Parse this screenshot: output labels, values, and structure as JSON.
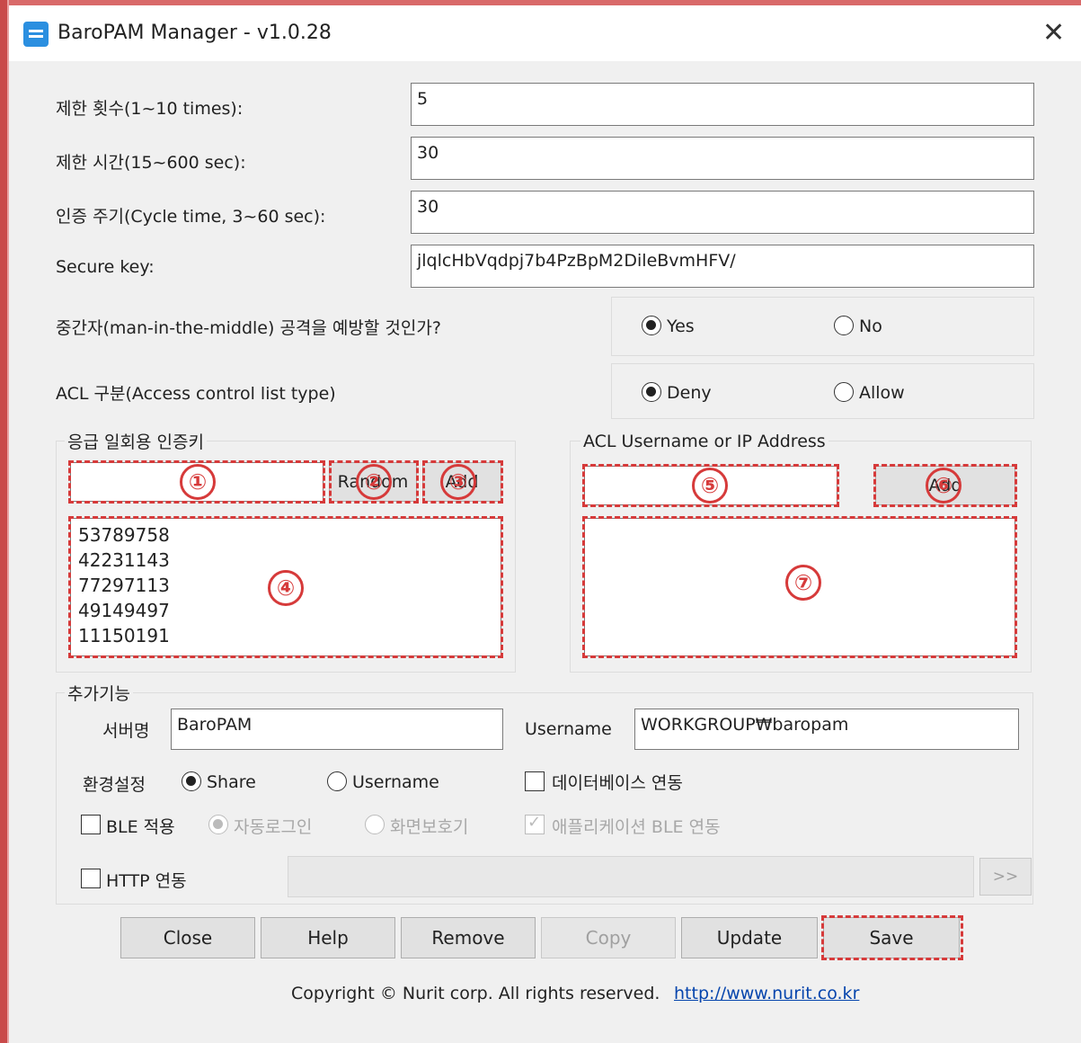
{
  "window": {
    "title": "BaroPAM Manager - v1.0.28",
    "close_glyph": "✕"
  },
  "settings": {
    "limit_count": {
      "label": "제한 횟수(1~10 times):",
      "value": "5"
    },
    "limit_time": {
      "label": "제한 시간(15~600 sec):",
      "value": "30"
    },
    "cycle": {
      "label": "인증 주기(Cycle time, 3~60 sec):",
      "value": "30"
    },
    "secure_key": {
      "label": "Secure key:",
      "value": "jlqlcHbVqdpj7b4PzBpM2DileBvmHFV/"
    }
  },
  "mitm": {
    "question": "중간자(man-in-the-middle) 공격을 예방할 것인가?",
    "yes": "Yes",
    "no": "No"
  },
  "acl_type": {
    "label": "ACL 구분(Access control list type)",
    "deny": "Deny",
    "allow": "Allow"
  },
  "emergency": {
    "title": "응급 일회용 인증키",
    "random_button": "Random",
    "add_button": "Add",
    "keys": [
      "53789758",
      "42231143",
      "77297113",
      "49149497",
      "11150191"
    ]
  },
  "acl_group": {
    "title": "ACL Username or IP Address",
    "add_button": "Add"
  },
  "extra": {
    "title": "추가기능",
    "server_label": "서버명",
    "server_value": "BaroPAM",
    "username_label": "Username",
    "username_value": "WORKGROUP₩baropam",
    "env_label": "환경설정",
    "share": "Share",
    "username_radio": "Username",
    "db_link": "데이터베이스 연동",
    "ble_apply": "BLE 적용",
    "auto_login": "자동로그인",
    "screensaver": "화면보호기",
    "app_ble": "애플리케이션 BLE 연동",
    "http_link": "HTTP 연동",
    "http_go": ">>"
  },
  "buttons": {
    "close": "Close",
    "help": "Help",
    "remove": "Remove",
    "copy": "Copy",
    "update": "Update",
    "save": "Save"
  },
  "footer": {
    "copyright": "Copyright © Nurit corp. All rights reserved.",
    "link": "http://www.nurit.co.kr"
  },
  "annotations": [
    "①",
    "②",
    "③",
    "④",
    "⑤",
    "⑥",
    "⑦"
  ],
  "colors": {
    "annotation": "#d63a3a",
    "window_bg": "#f0f0f0",
    "app_icon": "#2b8fe0",
    "link": "#0645ad"
  }
}
